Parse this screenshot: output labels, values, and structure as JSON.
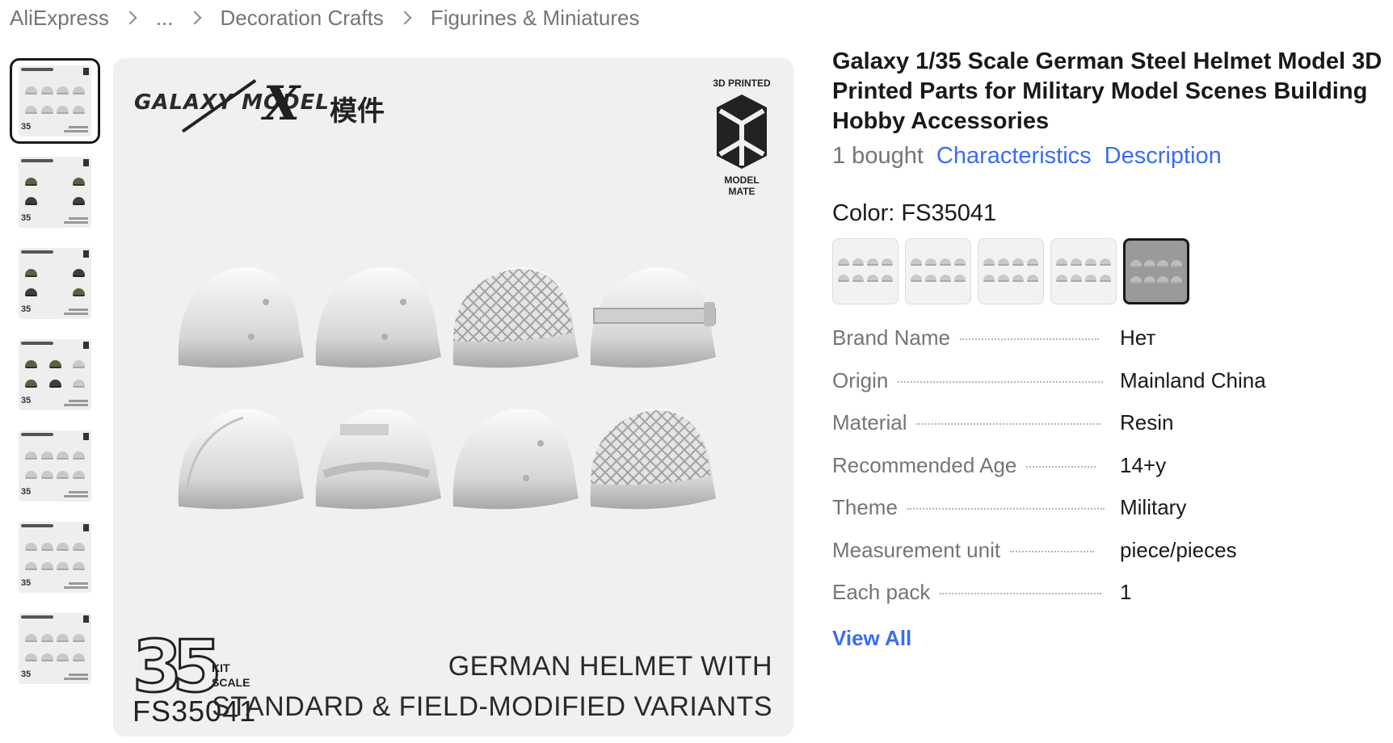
{
  "breadcrumb": {
    "items": [
      "AliExpress",
      "...",
      "Decoration Crafts",
      "Figurines & Miniatures"
    ]
  },
  "main_image": {
    "brand_logo": "GALAXY MODEL",
    "brand_x": "X",
    "brand_cn": "模件",
    "badge_top": "3D PRINTED",
    "badge_bottom": "MODEL MATE",
    "scale_number": "35",
    "scale_label_1": "KIT",
    "scale_label_2": "SCALE",
    "product_code": "FS35041",
    "caption_line_1": "GERMAN HELMET WITH",
    "caption_line_2": "STANDARD & FIELD-MODIFIED VARIANTS"
  },
  "product": {
    "title": "Galaxy 1/35 Scale German Steel Helmet Model 3D Printed Parts for Military Model Scenes Building Hobby Accessories",
    "sold": "1 bought",
    "link_characteristics": "Characteristics",
    "link_description": "Description",
    "color_label": "Color: FS35041"
  },
  "properties": [
    {
      "key": "Brand Name",
      "value": "Нет"
    },
    {
      "key": "Origin",
      "value": "Mainland China"
    },
    {
      "key": "Material",
      "value": "Resin"
    },
    {
      "key": "Recommended Age",
      "value": "14+y"
    },
    {
      "key": "Theme",
      "value": "Military"
    },
    {
      "key": "Measurement unit",
      "value": "piece/pieces"
    },
    {
      "key": "Each pack",
      "value": "1"
    }
  ],
  "view_all": "View All",
  "colors": {
    "accent_link": "#3a6df0",
    "text_secondary": "#757575",
    "selected_border": "#191919"
  }
}
